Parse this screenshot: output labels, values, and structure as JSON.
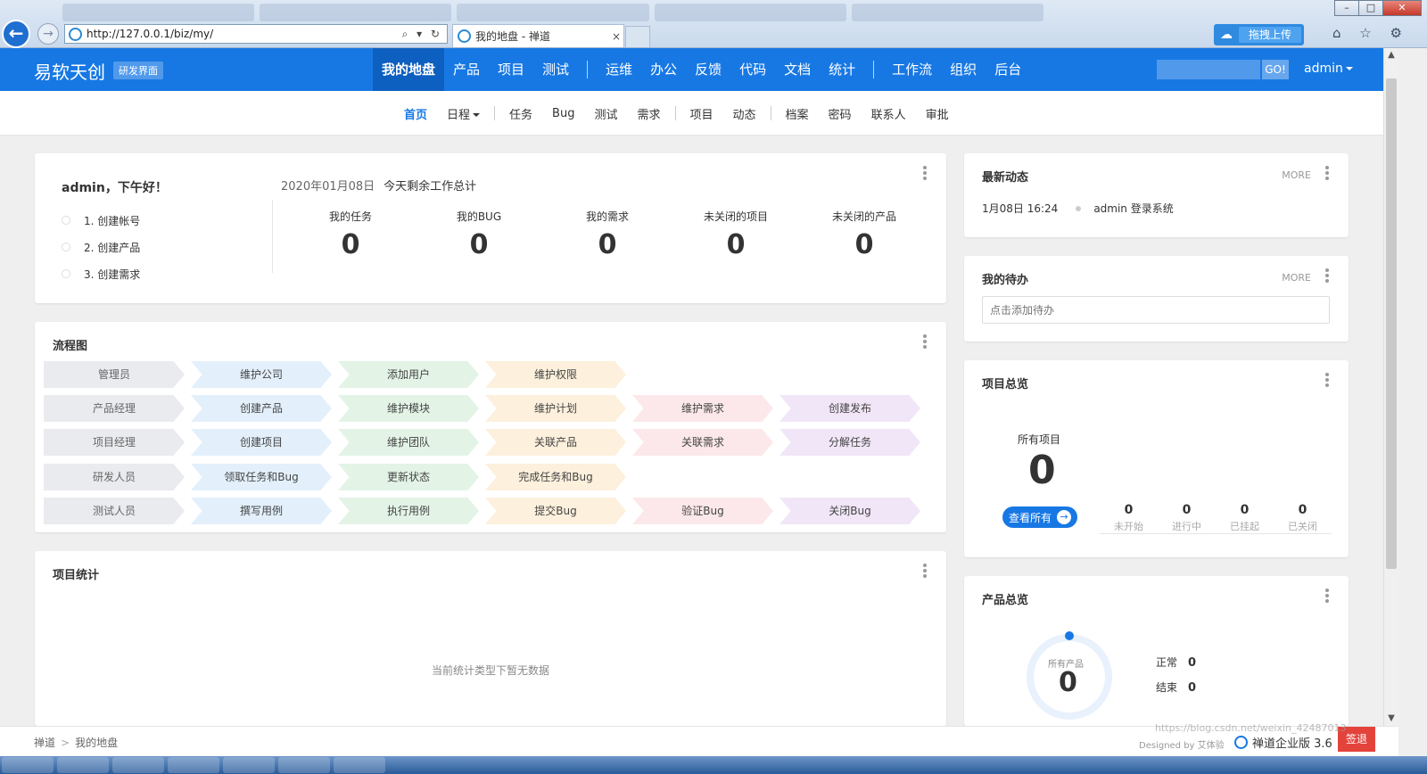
{
  "browser": {
    "url": "http://127.0.0.1/biz/my/",
    "tab_title": "我的地盘 - 禅道",
    "tab_close": "×",
    "upload_label": "拖拽上传",
    "back_glyph": "←",
    "fwd_glyph": "→",
    "addr_tools": "⌕ ▾ ↻",
    "icons": "⌂ ☆ ⚙",
    "win_min": "–",
    "win_max": "□",
    "win_close": "✕"
  },
  "header": {
    "brand": "易软天创",
    "brand_badge": "研发界面",
    "nav": [
      "我的地盘",
      "产品",
      "项目",
      "测试",
      "运维",
      "办公",
      "反馈",
      "代码",
      "文档",
      "统计",
      "工作流",
      "组织",
      "后台"
    ],
    "search_go": "GO!",
    "user": "admin"
  },
  "subnav": [
    "首页",
    "日程",
    "任务",
    "Bug",
    "测试",
    "需求",
    "项目",
    "动态",
    "档案",
    "密码",
    "联系人",
    "审批"
  ],
  "welcome": {
    "greeting": "admin，下午好！",
    "date": "2020年01月08日",
    "date_sub": "今天剩余工作总计",
    "steps": [
      "1. 创建帐号",
      "2. 创建产品",
      "3. 创建需求"
    ],
    "stats": [
      {
        "label": "我的任务",
        "value": "0"
      },
      {
        "label": "我的BUG",
        "value": "0"
      },
      {
        "label": "我的需求",
        "value": "0"
      },
      {
        "label": "未关闭的项目",
        "value": "0"
      },
      {
        "label": "未关闭的产品",
        "value": "0"
      }
    ]
  },
  "flow": {
    "title": "流程图",
    "rows": [
      [
        "管理员",
        "维护公司",
        "添加用户",
        "维护权限"
      ],
      [
        "产品经理",
        "创建产品",
        "维护模块",
        "维护计划",
        "维护需求",
        "创建发布"
      ],
      [
        "项目经理",
        "创建项目",
        "维护团队",
        "关联产品",
        "关联需求",
        "分解任务"
      ],
      [
        "研发人员",
        "领取任务和Bug",
        "更新状态",
        "完成任务和Bug"
      ],
      [
        "测试人员",
        "撰写用例",
        "执行用例",
        "提交Bug",
        "验证Bug",
        "关闭Bug"
      ]
    ]
  },
  "project_stats": {
    "title": "项目统计",
    "empty": "当前统计类型下暂无数据"
  },
  "activity": {
    "title": "最新动态",
    "more": "MORE",
    "items": [
      {
        "time": "1月08日 16:24",
        "text": "admin 登录系统"
      }
    ]
  },
  "todo": {
    "title": "我的待办",
    "more": "MORE",
    "placeholder": "点击添加待办"
  },
  "project_overview": {
    "title": "项目总览",
    "label": "所有项目",
    "value": "0",
    "button": "查看所有",
    "button_arrow": "→",
    "stats": [
      {
        "value": "0",
        "label": "未开始"
      },
      {
        "value": "0",
        "label": "进行中"
      },
      {
        "value": "0",
        "label": "已挂起"
      },
      {
        "value": "0",
        "label": "已关闭"
      }
    ]
  },
  "product_overview": {
    "title": "产品总览",
    "ring_label": "所有产品",
    "ring_value": "0",
    "stats": [
      {
        "label": "正常",
        "value": "0"
      },
      {
        "label": "结束",
        "value": "0"
      }
    ]
  },
  "footer": {
    "crumbs": [
      "禅道",
      "我的地盘"
    ],
    "designed": "Designed by 艾体验",
    "edition": "禅道企业版 3.6",
    "sign": "签退",
    "watermark": "https://blog.csdn.net/weixin_42487013"
  },
  "colors": {
    "brand_blue": "#1778e4",
    "nav_active": "#0d5fc0",
    "sign_red": "#e3433b"
  }
}
